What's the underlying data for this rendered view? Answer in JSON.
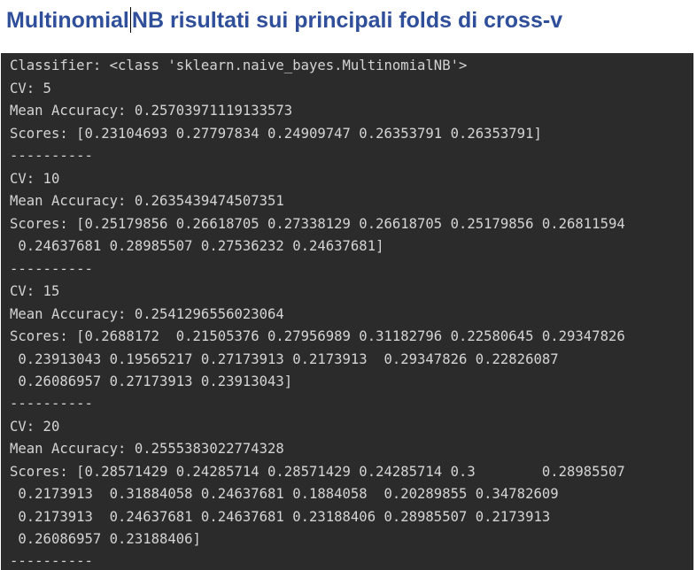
{
  "title_part1": "Multinomial",
  "title_part2": "NB risultati sui principali folds di cross-v",
  "console": {
    "lines": [
      "Classifier: <class 'sklearn.naive_bayes.MultinomialNB'>",
      "CV: 5",
      "Mean Accuracy: 0.25703971119133573",
      "Scores: [0.23104693 0.27797834 0.24909747 0.26353791 0.26353791]",
      "----------",
      "CV: 10",
      "Mean Accuracy: 0.2635439474507351",
      "Scores: [0.25179856 0.26618705 0.27338129 0.26618705 0.25179856 0.26811594",
      " 0.24637681 0.28985507 0.27536232 0.24637681]",
      "----------",
      "CV: 15",
      "Mean Accuracy: 0.2541296556023064",
      "Scores: [0.2688172  0.21505376 0.27956989 0.31182796 0.22580645 0.29347826",
      " 0.23913043 0.19565217 0.27173913 0.2173913  0.29347826 0.22826087",
      " 0.26086957 0.27173913 0.23913043]",
      "----------",
      "CV: 20",
      "Mean Accuracy: 0.2555383022774328",
      "Scores: [0.28571429 0.24285714 0.28571429 0.24285714 0.3        0.28985507",
      " 0.2173913  0.31884058 0.24637681 0.1884058  0.20289855 0.34782609",
      " 0.2173913  0.24637681 0.24637681 0.23188406 0.28985507 0.2173913",
      " 0.26086957 0.23188406]",
      "----------"
    ]
  }
}
